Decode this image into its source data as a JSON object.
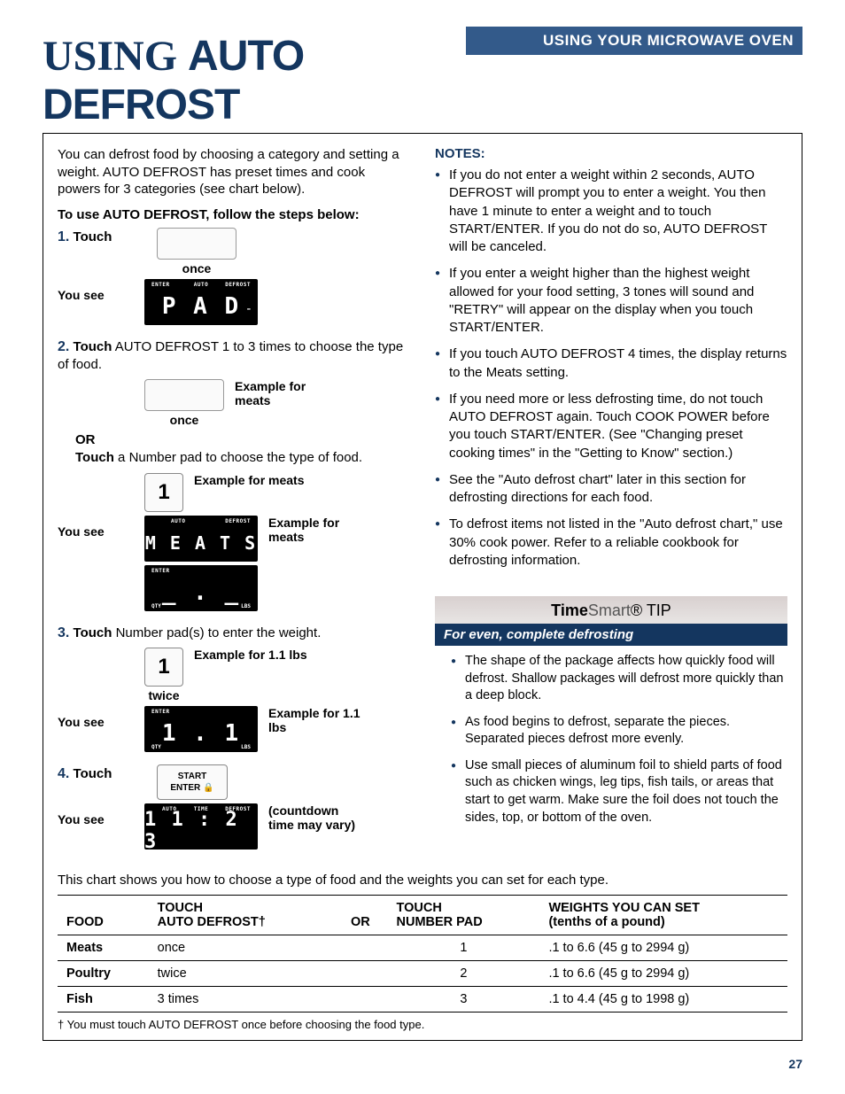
{
  "header_bar": "USING YOUR MICROWAVE OVEN",
  "page_title_1": "USING ",
  "page_title_2": "AUTO DEFROST",
  "intro": "You can defrost food by choosing a category and setting a weight. AUTO DEFROST has preset times and cook powers for 3 categories (see chart below).",
  "steps_intro": "To use AUTO DEFROST, follow the steps below:",
  "s1_num": "1.",
  "s1_touch": "Touch",
  "once": "once",
  "yousee": "You see",
  "disp1_ind1": "ENTER",
  "disp1_ind2": "AUTO",
  "disp1_ind3": "DEFROST",
  "disp1_main": "P A D",
  "s2_num": "2.",
  "s2_text_a": "Touch",
  "s2_text_b": " AUTO DEFROST 1 to 3 times to choose the type of food.",
  "s2_ex": "Example for meats",
  "or": "OR",
  "s2_alt_a": "Touch",
  "s2_alt_b": " a Number pad to choose the type of food.",
  "key1": "1",
  "s2_alt_ex": "Example for meats",
  "disp2_ind1": "AUTO",
  "disp2_ind2": "DEFROST",
  "disp2_main": "M E A T S",
  "disp2_ex": "Example for meats",
  "disp3_ind1": "ENTER",
  "disp3_bl": "QTY",
  "disp3_br": "LBS",
  "disp3_main": "_ . _",
  "s3_num": "3.",
  "s3_text_a": "Touch",
  "s3_text_b": " Number pad(s) to enter the weight.",
  "twice": "twice",
  "s3_ex": "Example for 1.1 lbs",
  "disp4_ind1": "ENTER",
  "disp4_main": "1 . 1",
  "disp4_bl": "QTY",
  "disp4_br": "LBS",
  "disp4_ex": "Example for 1.1 lbs",
  "s4_num": "4.",
  "s4_touch": "Touch",
  "start_lbl": "START",
  "enter_lbl": "ENTER",
  "disp5_ind1": "AUTO",
  "disp5_ind2": "TIME",
  "disp5_ind3": "DEFROST",
  "disp5_main": "1 1 : 2 3",
  "disp5_note": "(countdown time may vary)",
  "notes_head": "NOTES:",
  "notes": {
    "0": "If you do not enter a weight within 2 seconds, AUTO DEFROST will prompt you to enter a weight. You then have 1 minute to enter a weight and to touch START/ENTER. If you do not do so, AUTO DEFROST will be canceled.",
    "1": "If you enter a weight higher than the highest weight allowed for your food setting, 3 tones will sound and \"RETRY\" will appear on the display when you touch START/ENTER.",
    "2": "If you touch AUTO DEFROST 4 times, the display returns to the Meats setting.",
    "3": "If you need more or less defrosting time, do not touch AUTO DEFROST again. Touch COOK POWER before you touch START/ENTER. (See \"Changing preset cooking times\" in the \"Getting to Know\" section.)",
    "4": "See the \"Auto defrost chart\" later in this section for defrosting directions for each food.",
    "5": "To defrost items not listed in the \"Auto defrost chart,\" use 30% cook power. Refer to a reliable cookbook for defrosting information."
  },
  "tip_brand_1": "Time",
  "tip_brand_2": "Smart",
  "tip_brand_3": "® TIP",
  "tip_sub": "For even, complete defrosting",
  "tips": {
    "0": "The shape of the package affects how quickly food will defrost. Shallow packages will defrost more quickly than a deep block.",
    "1": "As food begins to defrost, separate the pieces. Separated pieces defrost more evenly.",
    "2": "Use small pieces of aluminum foil to shield parts of food such as chicken wings, leg tips, fish tails, or areas that start to get warm. Make sure the foil does not touch the sides, top, or bottom of the oven."
  },
  "chart_intro": "This chart shows you how to choose a type of food and the weights you can set for each type.",
  "th_food": "FOOD",
  "th_touch1a": "TOUCH",
  "th_touch1b": "AUTO DEFROST†",
  "th_or": "OR",
  "th_touch2a": "TOUCH",
  "th_touch2b": "NUMBER PAD",
  "th_weights_a": "WEIGHTS YOU CAN SET",
  "th_weights_b": "(tenths of a pound)",
  "chart_data": {
    "type": "table",
    "columns": [
      "FOOD",
      "TOUCH AUTO DEFROST†",
      "OR",
      "TOUCH NUMBER PAD",
      "WEIGHTS YOU CAN SET (tenths of a pound)"
    ],
    "rows": {
      "0": {
        "food": "Meats",
        "touch1": "once",
        "num": "1",
        "weights": ".1 to 6.6 (45 g to 2994 g)"
      },
      "1": {
        "food": "Poultry",
        "touch1": "twice",
        "num": "2",
        "weights": ".1 to 6.6 (45 g to 2994 g)"
      },
      "2": {
        "food": "Fish",
        "touch1": "3 times",
        "num": "3",
        "weights": ".1 to 4.4 (45 g to 1998 g)"
      }
    }
  },
  "footnote": "† You must touch AUTO DEFROST once before choosing the food type.",
  "page_num": "27"
}
